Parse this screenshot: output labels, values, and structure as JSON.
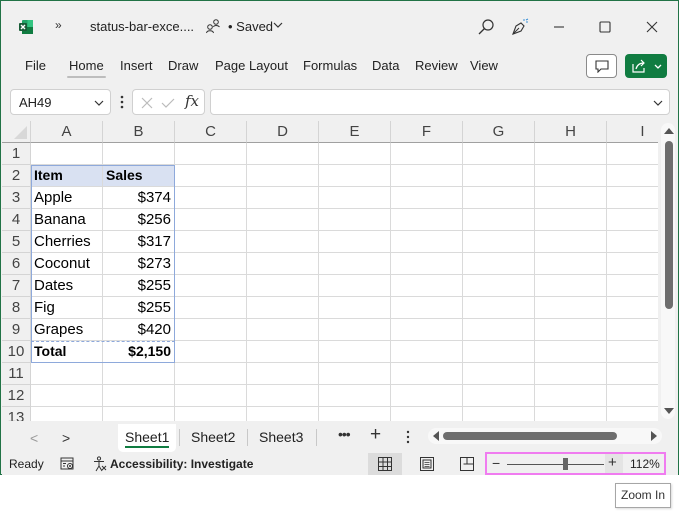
{
  "titlebar": {
    "app_icon": "excel-logo-icon",
    "overflow_icon": "double-chevron-right-icon",
    "overflow_label": "»",
    "doc_title": "status-bar-exce....",
    "save_status": "• Saved",
    "icons": [
      "share-person-icon",
      "chevron-down-icon",
      "search-icon",
      "pen-sparkle-icon",
      "minimize-icon",
      "maximize-icon",
      "close-icon"
    ]
  },
  "ribbon": {
    "tabs": [
      {
        "label": "File",
        "active": false
      },
      {
        "label": "Home",
        "active": true
      },
      {
        "label": "Insert",
        "active": false
      },
      {
        "label": "Draw",
        "active": false
      },
      {
        "label": "Page Layout",
        "active": false
      },
      {
        "label": "Formulas",
        "active": false
      },
      {
        "label": "Data",
        "active": false
      },
      {
        "label": "Review",
        "active": false
      },
      {
        "label": "View",
        "active": false
      }
    ],
    "comment_icon": "comment-icon",
    "share_icon": "share-icon",
    "share_color": "#107c41"
  },
  "formula_bar": {
    "name_box": "AH49",
    "cancel_icon": "cancel-x-icon",
    "enter_icon": "checkmark-icon",
    "fx_label": "fx",
    "formula_value": ""
  },
  "grid": {
    "columns": [
      "A",
      "B",
      "C",
      "D",
      "E",
      "F",
      "G",
      "H",
      "I"
    ],
    "rows": [
      "1",
      "2",
      "3",
      "4",
      "5",
      "6",
      "7",
      "8",
      "9",
      "10",
      "11",
      "12",
      "13"
    ],
    "table": {
      "header": {
        "item": "Item",
        "sales": "Sales"
      },
      "rows": [
        {
          "item": "Apple",
          "sales": "$374"
        },
        {
          "item": "Banana",
          "sales": "$256"
        },
        {
          "item": "Cherries",
          "sales": "$317"
        },
        {
          "item": "Coconut",
          "sales": "$273"
        },
        {
          "item": "Dates",
          "sales": "$255"
        },
        {
          "item": "Fig",
          "sales": "$255"
        },
        {
          "item": "Grapes",
          "sales": "$420"
        }
      ],
      "total": {
        "item": "Total",
        "sales": "$2,150"
      },
      "header_fill": "#d9e1f2",
      "border_color": "#8ea9db"
    }
  },
  "sheets": {
    "prev_label": "<",
    "next_label": ">",
    "tabs": [
      {
        "label": "Sheet1",
        "active": true
      },
      {
        "label": "Sheet2",
        "active": false
      },
      {
        "label": "Sheet3",
        "active": false
      }
    ],
    "more_label": "•••",
    "add_label": "+"
  },
  "statusbar": {
    "mode": "Ready",
    "accessibility": "Accessibility: Investigate",
    "views": [
      "normal-view-icon",
      "page-layout-view-icon",
      "page-break-preview-icon"
    ],
    "zoom": {
      "minus_label": "−",
      "plus_label": "+",
      "percent": "112%",
      "value": 112
    }
  },
  "tooltip": {
    "text": "Zoom In"
  }
}
